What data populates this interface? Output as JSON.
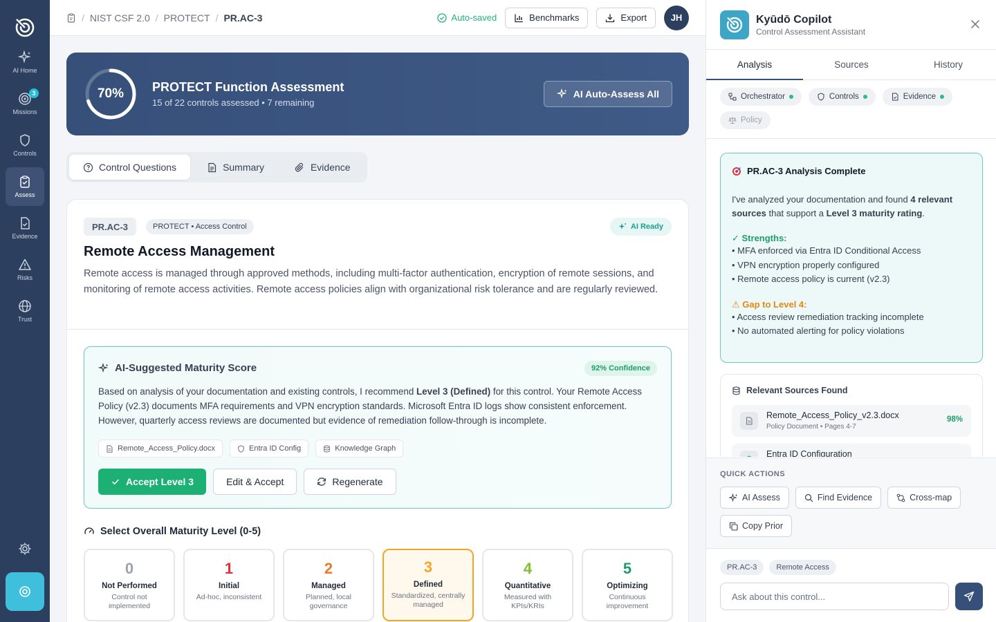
{
  "sidebar": {
    "items": [
      {
        "label": "AI Home"
      },
      {
        "label": "Missions",
        "badge": "3"
      },
      {
        "label": "Controls"
      },
      {
        "label": "Assess"
      },
      {
        "label": "Evidence"
      },
      {
        "label": "Risks"
      },
      {
        "label": "Trust"
      }
    ],
    "active": "Assess"
  },
  "breadcrumb": [
    "NIST CSF 2.0",
    "PROTECT",
    "PR.AC-3"
  ],
  "topbar": {
    "saved_label": "Auto-saved",
    "benchmarks_label": "Benchmarks",
    "export_label": "Export",
    "avatar_initials": "JH"
  },
  "hero": {
    "percent": "70%",
    "progress_fraction": 0.7,
    "title": "PROTECT Function Assessment",
    "subtitle": "15 of 22 controls assessed • 7 remaining",
    "button_label": "AI Auto-Assess All"
  },
  "tabs": [
    "Control Questions",
    "Summary",
    "Evidence"
  ],
  "control": {
    "id": "PR.AC-3",
    "category": "PROTECT • Access Control",
    "status": "AI Ready",
    "title": "Remote Access Management",
    "description": "Remote access is managed through approved methods, including multi-factor authentication, encryption of remote sessions, and monitoring of remote access activities. Remote access policies align with organizational risk tolerance and are regularly reviewed."
  },
  "suggestion": {
    "title": "AI-Suggested Maturity Score",
    "confidence": "92% Confidence",
    "text_before": "Based on analysis of your documentation and existing controls, I recommend ",
    "text_bold": "Level 3 (Defined)",
    "text_after": " for this control. Your Remote Access Policy (v2.3) documents MFA requirements and VPN encryption standards. Microsoft Entra ID logs show consistent enforcement. However, quarterly access reviews are documented but evidence of remediation follow-through is incomplete.",
    "chips": [
      "Remote_Access_Policy.docx",
      "Entra ID Config",
      "Knowledge Graph"
    ],
    "accept_label": "Accept Level 3",
    "edit_label": "Edit & Accept",
    "regen_label": "Regenerate"
  },
  "maturity": {
    "heading": "Select Overall Maturity Level (0-5)",
    "selected": 3,
    "levels": [
      {
        "num": "0",
        "name": "Not Performed",
        "desc": "Control not implemented",
        "color": "#9ca3af"
      },
      {
        "num": "1",
        "name": "Initial",
        "desc": "Ad-hoc, inconsistent",
        "color": "#e0303a"
      },
      {
        "num": "2",
        "name": "Managed",
        "desc": "Planned, local governance",
        "color": "#f0782a"
      },
      {
        "num": "3",
        "name": "Defined",
        "desc": "Standardized, centrally managed",
        "color": "#f5a524"
      },
      {
        "num": "4",
        "name": "Quantitative",
        "desc": "Measured with KPIs/KRIs",
        "color": "#7cc22e"
      },
      {
        "num": "5",
        "name": "Optimizing",
        "desc": "Continuous improvement",
        "color": "#1f9d6a"
      }
    ]
  },
  "copilot": {
    "title": "Kyūdō Copilot",
    "subtitle": "Control Assessment Assistant",
    "tabs": [
      "Analysis",
      "Sources",
      "History"
    ],
    "agents": [
      "Orchestrator",
      "Controls",
      "Evidence",
      "Policy"
    ],
    "analysis": {
      "title": "PR.AC-3 Analysis Complete",
      "intro_1": "I've analyzed your documentation and found ",
      "intro_bold_1": "4 relevant sources",
      "intro_2": " that support a ",
      "intro_bold_2": "Level 3 maturity rating",
      "intro_3": ".",
      "strengths_label": "✓ Strengths:",
      "strengths": [
        "• MFA enforced via Entra ID Conditional Access",
        "• VPN encryption properly configured",
        "• Remote access policy is current (v2.3)"
      ],
      "gap_label": "Gap to Level 4:",
      "gaps": [
        "• Access review remediation tracking incomplete",
        "• No automated alerting for policy violations"
      ]
    },
    "sources": {
      "heading": "Relevant Sources Found",
      "items": [
        {
          "name": "Remote_Access_Policy_v2.3.docx",
          "meta": "Policy Document • Pages 4-7",
          "pct": "98%"
        },
        {
          "name": "Entra ID Configuration",
          "meta": "",
          "pct": ""
        }
      ]
    },
    "quick_actions_label": "QUICK ACTIONS",
    "quick_actions": [
      "AI Assess",
      "Find Evidence",
      "Cross-map",
      "Copy Prior"
    ],
    "context_chips": [
      "PR.AC-3",
      "Remote Access"
    ],
    "ask_placeholder": "Ask about this control..."
  }
}
